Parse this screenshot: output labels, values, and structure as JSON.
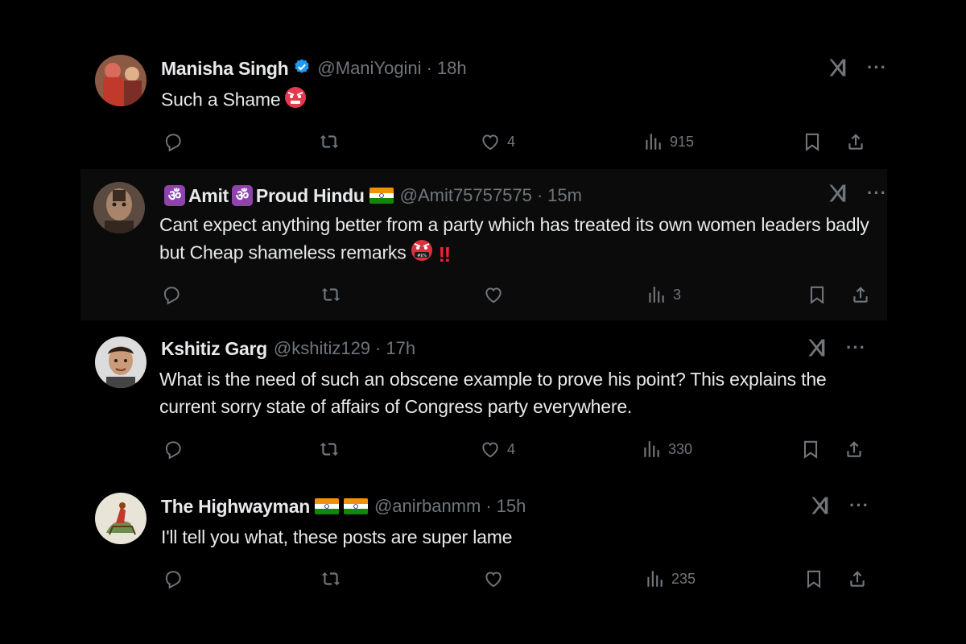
{
  "tweets": [
    {
      "name": "Manisha Singh",
      "handle": "@ManiYogini",
      "time": "18h",
      "verified": true,
      "text": "Such a Shame",
      "stats": {
        "replies": "",
        "reposts": "",
        "likes": "4",
        "views": "915"
      }
    },
    {
      "name_part1": "Amit",
      "name_part2": "Proud Hindu",
      "handle": "@Amit75757575",
      "time": "15m",
      "text": "Cant expect anything better from a party which has treated its own women leaders badly but Cheap shameless remarks",
      "stats": {
        "replies": "",
        "reposts": "",
        "likes": "",
        "views": "3"
      }
    },
    {
      "name": "Kshitiz Garg",
      "handle": "@kshitiz129",
      "time": "17h",
      "text": "What is the need of such an obscene example to prove his point? This explains the current sorry state of affairs of Congress party everywhere.",
      "stats": {
        "replies": "",
        "reposts": "",
        "likes": "4",
        "views": "330"
      }
    },
    {
      "name": "The Highwayman",
      "handle": "@anirbanmm",
      "time": "15h",
      "text": "I'll tell you what, these posts are super lame",
      "stats": {
        "replies": "",
        "reposts": "",
        "likes": "",
        "views": "235"
      }
    }
  ],
  "icons": {
    "reply": "reply-icon",
    "repost": "repost-icon",
    "like": "heart-icon",
    "views": "views-icon",
    "bookmark": "bookmark-icon",
    "share": "share-icon",
    "grok": "grok-icon",
    "more": "more-icon",
    "verified": "verified-badge-icon"
  },
  "colors": {
    "background": "#000000",
    "text": "#e7e9ea",
    "muted": "#71767b",
    "verified": "#1d9bf0"
  }
}
